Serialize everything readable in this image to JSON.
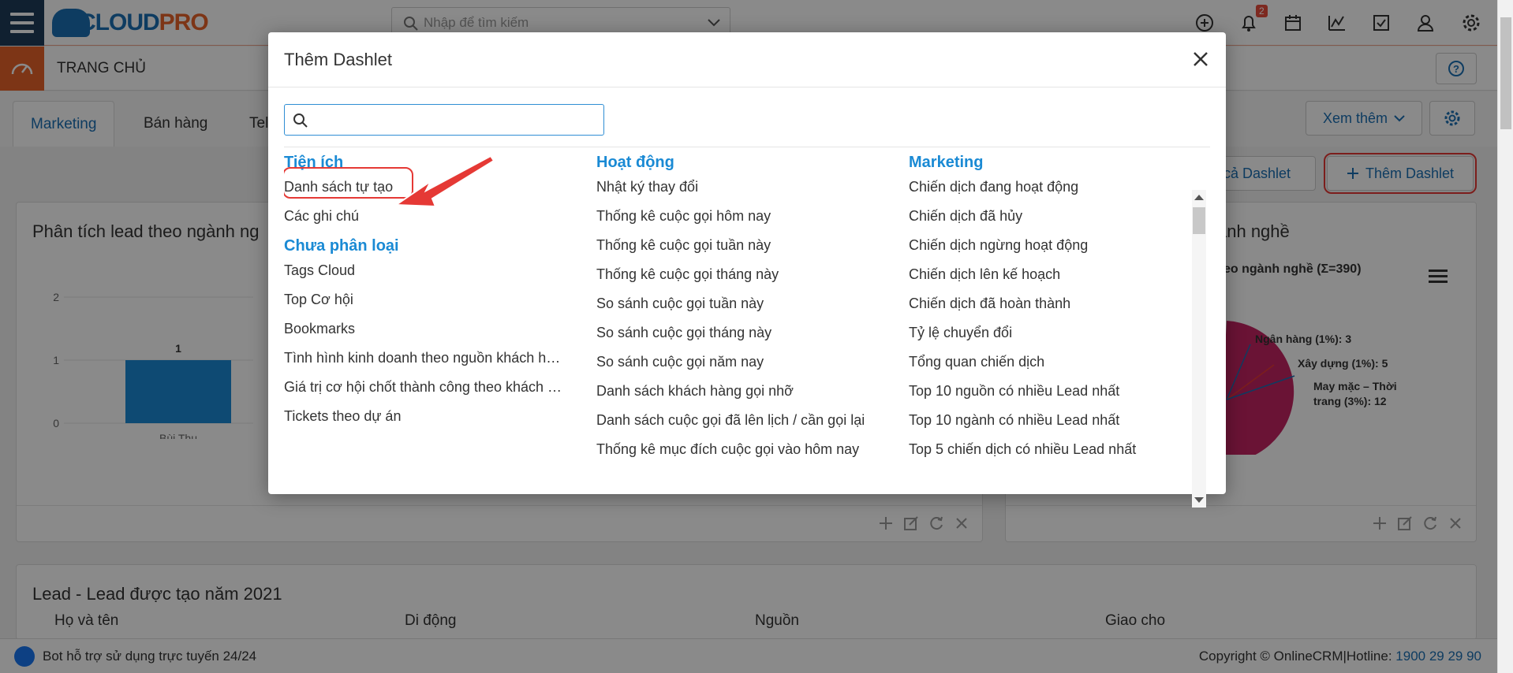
{
  "header": {
    "logo_text_blue": "CLOUD",
    "logo_text_orange": "PRO",
    "search_placeholder": "Nhập để tìm kiếm",
    "notification_count": "2"
  },
  "subbar": {
    "title": "TRANG CHỦ"
  },
  "tabs": [
    {
      "label": "Marketing",
      "active": true
    },
    {
      "label": "Bán hàng",
      "active": false
    },
    {
      "label": "Tel",
      "active": false
    }
  ],
  "tab_actions": {
    "more_label": "Xem thêm"
  },
  "dashlet_actions": {
    "all_label": "Tất cả Dashlet",
    "add_label": "Thêm Dashlet"
  },
  "widgets": {
    "left": {
      "title": "Phân tích lead theo ngành ng",
      "chart_data": {
        "type": "bar",
        "categories": [
          "Bùi Thu"
        ],
        "values": [
          1
        ],
        "ylim": [
          0,
          2
        ],
        "yticks": [
          "2",
          "1",
          "0"
        ],
        "bar_color": "#1a8ad4"
      }
    },
    "right": {
      "title": "ành nghề",
      "subtitle": "eo ngành nghề (Σ=390)",
      "chart_data": {
        "type": "pie",
        "labels": [
          "Ngân hàng (1%): 3",
          "Xây dựng (1%): 5",
          "May mặc – Thời",
          "trang (3%): 12"
        ],
        "values": [
          3,
          5,
          12
        ],
        "main_color": "#c2185b"
      }
    },
    "bottom": {
      "title": "Lead - Lead được tạo năm 2021",
      "columns": [
        "Họ và tên",
        "Di động",
        "Nguồn",
        "Giao cho"
      ]
    }
  },
  "bottombar": {
    "bot_text": "Bot hỗ trợ sử dụng trực tuyến 24/24",
    "copyright": "Copyright © OnlineCRM|Hotline:",
    "hotline": "1900 29 29 90"
  },
  "modal": {
    "title": "Thêm Dashlet",
    "search_placeholder": "",
    "columns": [
      {
        "sections": [
          {
            "heading": "Tiện ích",
            "items": [
              "Danh sách tự tạo",
              "Các ghi chú"
            ]
          },
          {
            "heading": "Chưa phân loại",
            "items": [
              "Tags Cloud",
              "Top Cơ hội",
              "Bookmarks",
              "Tình hình kinh doanh theo nguồn khách hàng",
              "Giá trị cơ hội chốt thành công theo khách hàng",
              "Tickets theo dự án"
            ]
          }
        ]
      },
      {
        "sections": [
          {
            "heading": "Hoạt động",
            "items": [
              "Nhật ký thay đổi",
              "Thống kê cuộc gọi hôm nay",
              "Thống kê cuộc gọi tuần này",
              "Thống kê cuộc gọi tháng này",
              "So sánh cuộc gọi tuần này",
              "So sánh cuộc gọi tháng này",
              "So sánh cuộc gọi năm nay",
              "Danh sách khách hàng gọi nhỡ",
              "Danh sách cuộc gọi đã lên lịch / cần gọi lại",
              "Thống kê mục đích cuộc gọi vào hôm nay"
            ]
          }
        ]
      },
      {
        "sections": [
          {
            "heading": "Marketing",
            "items": [
              "Chiến dịch đang hoạt động",
              "Chiến dịch đã hủy",
              "Chiến dịch ngừng hoạt động",
              "Chiến dịch lên kế hoạch",
              "Chiến dịch đã hoàn thành",
              "Tỷ lệ chuyển đổi",
              "Tổng quan chiến dịch",
              "Top 10 nguồn có nhiều Lead nhất",
              "Top 10 ngành có nhiều Lead nhất",
              "Top 5 chiến dịch có nhiều Lead nhất"
            ]
          }
        ]
      }
    ]
  }
}
